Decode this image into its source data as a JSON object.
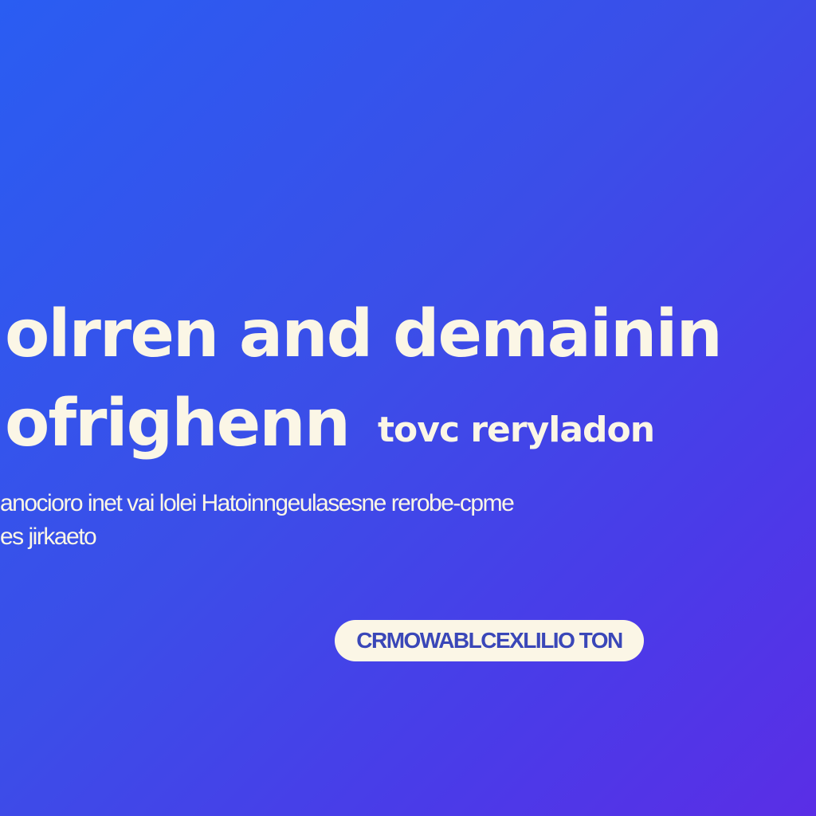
{
  "hero": {
    "headline_line_1": "olrren and demainin",
    "headline_line_2": "ofrighenn",
    "headline_line_2_small": "tovc reryladon",
    "subtext_line_1": "anocioro inet vai lolei Hatoinngeulasesne rerobe-cpme",
    "subtext_line_2": "es jirkaeto",
    "cta_label": "CRMOWABLCEXLILIO TON"
  },
  "colors": {
    "gradient_start": "#2a5df2",
    "gradient_end": "#5a2ee6",
    "text": "#fbf6e6",
    "button_bg": "#fbf6e6",
    "button_text": "#3a47b8"
  }
}
